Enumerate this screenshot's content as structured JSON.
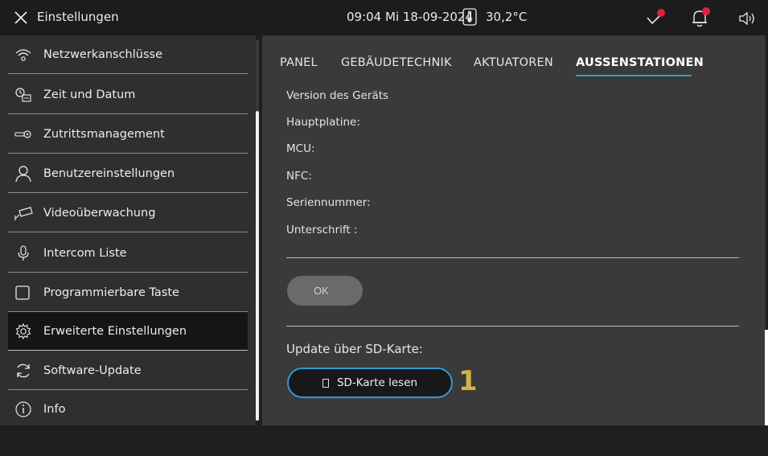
{
  "header": {
    "title": "Einstellungen",
    "datetime": "09:04  Mi 18-09-2024",
    "temperature": "30,2°C"
  },
  "sidebar": {
    "items": [
      {
        "label": "Netzwerkanschlüsse",
        "icon": "wifi-icon"
      },
      {
        "label": "Zeit und Datum",
        "icon": "clock-calendar-icon"
      },
      {
        "label": "Zutrittsmanagement",
        "icon": "key-icon"
      },
      {
        "label": "Benutzereinstellungen",
        "icon": "user-icon"
      },
      {
        "label": "Videoüberwachung",
        "icon": "camera-icon"
      },
      {
        "label": "Intercom Liste",
        "icon": "microphone-icon"
      },
      {
        "label": "Programmierbare Taste",
        "icon": "square-button-icon"
      },
      {
        "label": "Erweiterte Einstellungen",
        "icon": "gear-icon",
        "active": true
      },
      {
        "label": "Software-Update",
        "icon": "refresh-icon"
      },
      {
        "label": "Info",
        "icon": "info-icon"
      }
    ]
  },
  "tabs": [
    {
      "label": "PANEL"
    },
    {
      "label": "GEBÄUDETECHNIK"
    },
    {
      "label": "AKTUATOREN"
    },
    {
      "label": "AUSSENSTATIONEN",
      "active": true
    }
  ],
  "device_info": {
    "version_heading": "Version des Geräts",
    "mainboard": "Hauptplatine:",
    "mcu": "MCU:",
    "nfc": "NFC:",
    "serial": "Seriennummer:",
    "signature": "Unterschrift :"
  },
  "buttons": {
    "ok_label": "OK",
    "sd_heading": "Update über SD-Karte:",
    "sd_read_label": "SD-Karte lesen"
  },
  "callout_number": "1",
  "colors": {
    "accent": "#2f9bd8",
    "notification": "#e0213a",
    "callout": "#d4b146",
    "active_item": "#151515"
  }
}
